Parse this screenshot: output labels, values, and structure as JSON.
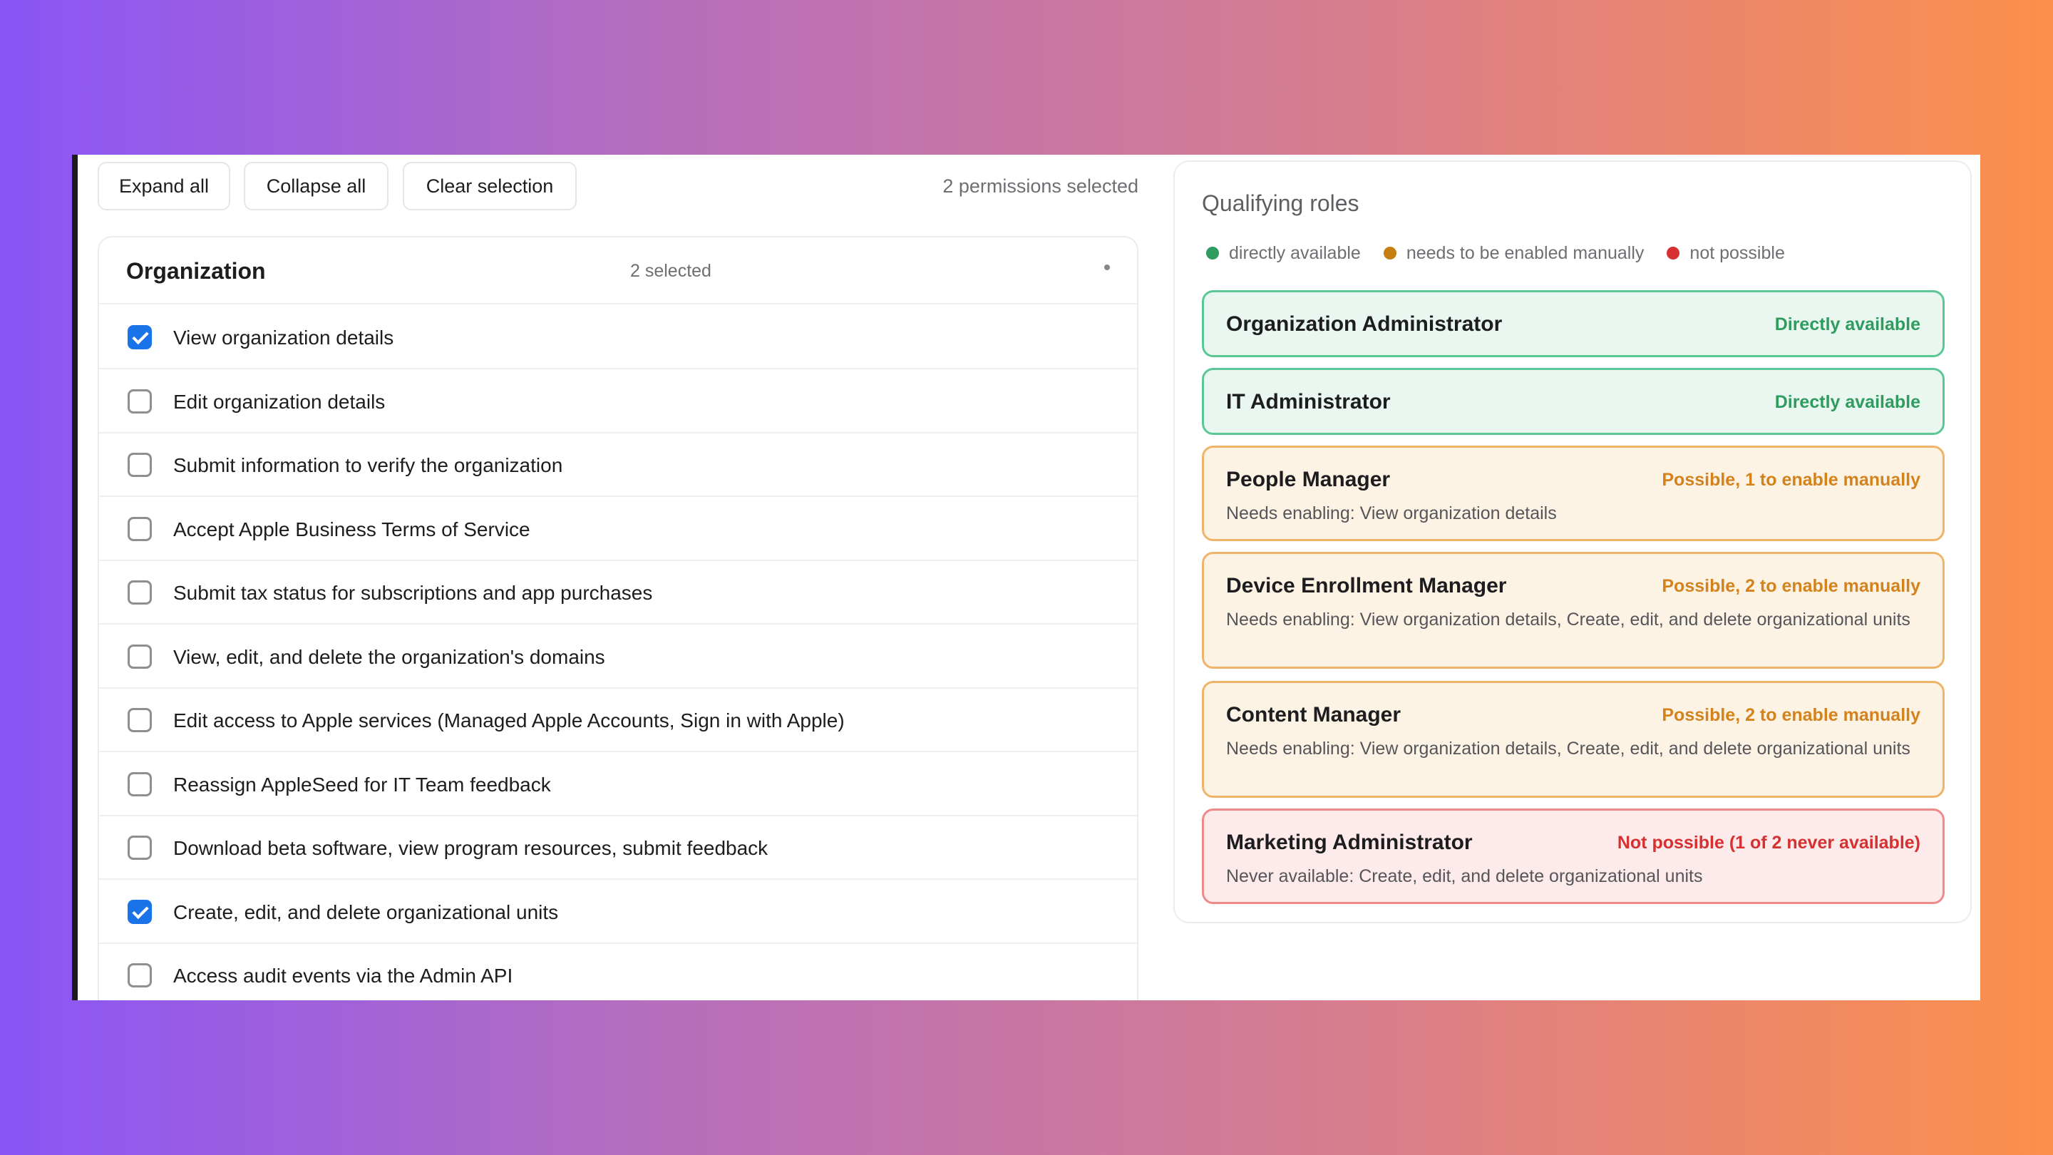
{
  "toolbar": {
    "expand_all": "Expand all",
    "collapse_all": "Collapse all",
    "clear_selection": "Clear selection",
    "selected_count": "2 permissions selected"
  },
  "group": {
    "title": "Organization",
    "selected": "2 selected"
  },
  "permissions": [
    {
      "label": "View organization details",
      "checked": true
    },
    {
      "label": "Edit organization details",
      "checked": false
    },
    {
      "label": "Submit information to verify the organization",
      "checked": false
    },
    {
      "label": "Accept Apple Business Terms of Service",
      "checked": false
    },
    {
      "label": "Submit tax status for subscriptions and app purchases",
      "checked": false
    },
    {
      "label": "View, edit, and delete the organization's domains",
      "checked": false
    },
    {
      "label": "Edit access to Apple services (Managed Apple Accounts, Sign in with Apple)",
      "checked": false
    },
    {
      "label": "Reassign AppleSeed for IT Team feedback",
      "checked": false
    },
    {
      "label": "Download beta software, view program resources, submit feedback",
      "checked": false
    },
    {
      "label": "Create, edit, and delete organizational units",
      "checked": true
    },
    {
      "label": "Access audit events via the Admin API",
      "checked": false
    }
  ],
  "qualifying": {
    "title": "Qualifying roles",
    "legend": [
      {
        "label": "directly available",
        "color": "#2e9b5f"
      },
      {
        "label": "needs to be enabled manually",
        "color": "#c57e12"
      },
      {
        "label": "not possible",
        "color": "#d63030"
      }
    ],
    "roles": [
      {
        "name": "Organization Administrator",
        "status": "Directly available",
        "detail": "",
        "kind": "green"
      },
      {
        "name": "IT Administrator",
        "status": "Directly available",
        "detail": "",
        "kind": "green"
      },
      {
        "name": "People Manager",
        "status": "Possible, 1 to enable manually",
        "detail": "Needs enabling: View organization details",
        "kind": "orange"
      },
      {
        "name": "Device Enrollment Manager",
        "status": "Possible, 2 to enable manually",
        "detail": "Needs enabling: View organization details, Create, edit, and delete organizational units",
        "kind": "orange"
      },
      {
        "name": "Content Manager",
        "status": "Possible, 2 to enable manually",
        "detail": "Needs enabling: View organization details, Create, edit, and delete organizational units",
        "kind": "orange"
      },
      {
        "name": "Marketing Administrator",
        "status": "Not possible (1 of 2 never available)",
        "detail": "Never available: Create, edit, and delete organizational units",
        "kind": "red"
      }
    ]
  }
}
